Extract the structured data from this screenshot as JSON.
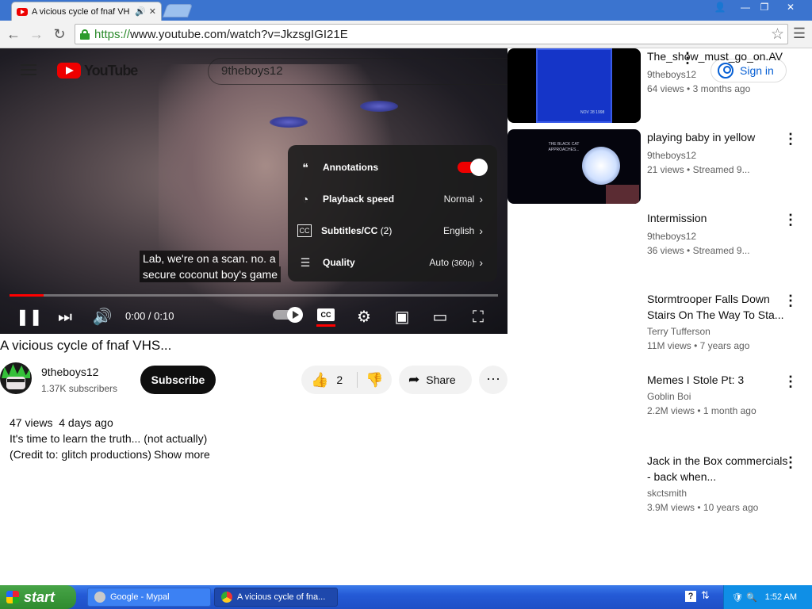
{
  "browser": {
    "tab_title": "A vicious cycle of fnaf VH",
    "tab_audio_icon": "🔊",
    "tab_close": "✕",
    "url_scheme": "https://",
    "url_rest": "www.youtube.com/watch?v=JkzsgIGI21E"
  },
  "masthead": {
    "logo_text": "YouTube",
    "search_value": "9theboys12",
    "signin_label": "Sign in"
  },
  "player": {
    "captions": [
      "Lab, we're on a scan. no. a",
      "secure coconut boy's game"
    ],
    "time": "0:00 / 0:10",
    "cc_label": "CC",
    "progress_fraction": 0.07,
    "settings": [
      {
        "label": "Annotations",
        "value": "",
        "icon": "annotations-icon"
      },
      {
        "label": "Playback speed",
        "value": "Normal",
        "icon": "speed-icon"
      },
      {
        "label": "Subtitles/CC",
        "count": "(2)",
        "value": "English",
        "icon": "cc-icon"
      },
      {
        "label": "Quality",
        "value": "Auto",
        "value_detail": "(360p)",
        "icon": "sliders-icon"
      }
    ]
  },
  "video": {
    "title": "A vicious cycle of fnaf VHS...",
    "channel_name": "9theboys12",
    "subscribers": "1.37K subscribers",
    "subscribe_label": "Subscribe",
    "like_count": "2",
    "share_label": "Share",
    "views": "47 views",
    "date": "4 days ago",
    "description_line1": "It's time to learn the truth... (not actually)",
    "description_line2": "(Credit to: glitch productions)",
    "show_more": "Show more"
  },
  "recommendations": [
    {
      "title": "The_show_must_go_on.AV",
      "channel": "9theboys12",
      "views": "64 views",
      "age": "3 months ago",
      "thumb_text": "NOV 28 1998"
    },
    {
      "title": "playing baby in yellow",
      "channel": "9theboys12",
      "views": "21 views",
      "age": "Streamed 9...",
      "thumb_text": "THE BLACK CAT APPROACHES..."
    },
    {
      "title": "Intermission",
      "channel": "9theboys12",
      "views": "36 views",
      "age": "Streamed 9..."
    },
    {
      "title": "Stormtrooper Falls Down Stairs On The Way To Sta...",
      "channel": "Terry Tufferson",
      "views": "11M views",
      "age": "7 years ago"
    },
    {
      "title": "Memes I Stole Pt: 3",
      "channel": "Goblin Boi",
      "views": "2.2M views",
      "age": "1 month ago"
    },
    {
      "title": "Jack in the Box commercials - back when...",
      "channel": "skctsmith",
      "views": "3.9M views",
      "age": "10 years ago"
    }
  ],
  "taskbar": {
    "start_label": "start",
    "task1": "Google - Mypal",
    "task2": "A vicious cycle of fna...",
    "clock": "1:52 AM"
  },
  "colors": {
    "accent_red": "#ff0000",
    "link_blue": "#065fd4",
    "xp_blue": "#245ad6"
  }
}
